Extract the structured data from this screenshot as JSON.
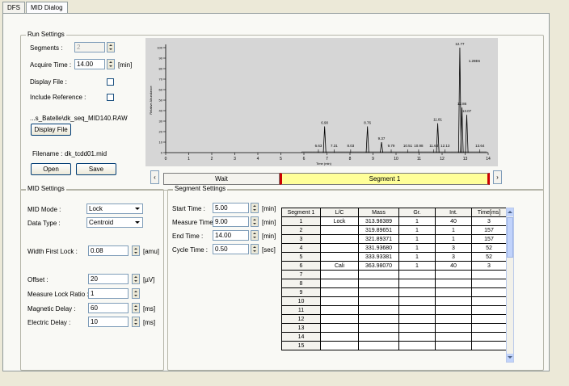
{
  "tabs": [
    {
      "label": "DFS"
    },
    {
      "label": "MID Dialog"
    }
  ],
  "run_settings": {
    "title": "Run Settings",
    "segments_label": "Segments :",
    "segments_value": "2",
    "acquire_time_label": "Acquire Time :",
    "acquire_time_value": "14.00",
    "acquire_time_unit": "[min]",
    "display_file_label": "Display File :",
    "include_reference_label": "Include Reference :",
    "file_path": "...s_Batelle\\dk_seq_MID140.RAW",
    "display_file_button": "Display File",
    "filename_label": "Filename :",
    "filename_value": "dk_tcdd01.mid",
    "open_button": "Open",
    "save_button": "Save"
  },
  "chart_data": {
    "type": "line",
    "xlabel": "Time (min)",
    "ylabel": "Relative Abundance",
    "xlim": [
      0,
      14
    ],
    "ylim": [
      0,
      100
    ],
    "x_ticks": [
      "0",
      "1",
      "2",
      "3",
      "4",
      "5",
      "6",
      "7",
      "8",
      "9",
      "10",
      "11",
      "12",
      "13",
      "14"
    ],
    "y_ticks": [
      "0",
      "10",
      "20",
      "30",
      "40",
      "50",
      "60",
      "70",
      "80",
      "90",
      "100"
    ],
    "scale_label": "1.28E6",
    "peaks": [
      {
        "label": "6.63",
        "x": 6.63,
        "y": 3
      },
      {
        "label": "6.90",
        "x": 6.9,
        "y": 25
      },
      {
        "label": "7.31",
        "x": 7.31,
        "y": 3
      },
      {
        "label": "8.03",
        "x": 8.03,
        "y": 3
      },
      {
        "label": "8.76",
        "x": 8.76,
        "y": 25
      },
      {
        "label": "9.37",
        "x": 9.37,
        "y": 10
      },
      {
        "label": "9.79",
        "x": 9.79,
        "y": 3
      },
      {
        "label": "10.51",
        "x": 10.51,
        "y": 3
      },
      {
        "label": "10.98",
        "x": 10.98,
        "y": 3
      },
      {
        "label": "11.64",
        "x": 11.64,
        "y": 3
      },
      {
        "label": "11.81",
        "x": 11.81,
        "y": 28
      },
      {
        "label": "12.13",
        "x": 12.13,
        "y": 3
      },
      {
        "label": "12.77",
        "x": 12.77,
        "y": 100
      },
      {
        "label": "12.86",
        "x": 12.86,
        "y": 43
      },
      {
        "label": "13.07",
        "x": 13.07,
        "y": 36
      },
      {
        "label": "13.64",
        "x": 13.64,
        "y": 3
      }
    ]
  },
  "timeline": {
    "wait_label": "Wait",
    "segment_label": "Segment 1"
  },
  "mid_settings": {
    "title": "MID Settings",
    "mid_mode_label": "MID Mode :",
    "mid_mode_value": "Lock",
    "data_type_label": "Data Type :",
    "data_type_value": "Centroid",
    "width_first_lock_label": "Width First Lock :",
    "width_first_lock_value": "0.08",
    "width_first_lock_unit": "[amu]",
    "offset_label": "Offset :",
    "offset_value": "20",
    "offset_unit": "[µV]",
    "measure_lock_ratio_label": "Measure Lock Ratio :",
    "measure_lock_ratio_value": "1",
    "magnetic_delay_label": "Magnetic Delay :",
    "magnetic_delay_value": "60",
    "magnetic_delay_unit": "[ms]",
    "electric_delay_label": "Electric Delay :",
    "electric_delay_value": "10",
    "electric_delay_unit": "[ms]"
  },
  "segment_settings": {
    "title": "Segment Settings",
    "start_time_label": "Start Time :",
    "start_time_value": "5.00",
    "start_time_unit": "[min]",
    "measure_time_label": "Measure Time :",
    "measure_time_value": "9.00",
    "measure_time_unit": "[min]",
    "end_time_label": "End Time :",
    "end_time_value": "14.00",
    "end_time_unit": "[min]",
    "cycle_time_label": "Cycle Time :",
    "cycle_time_value": "0.50",
    "cycle_time_unit": "[sec]"
  },
  "segment_table": {
    "headers": [
      "Segment 1",
      "L/C",
      "Mass",
      "Gr.",
      "Int.",
      "Time[ms]"
    ],
    "rows": [
      [
        "1",
        "Lock",
        "313.98389",
        "1",
        "40",
        "3"
      ],
      [
        "2",
        "",
        "319.89651",
        "1",
        "1",
        "157"
      ],
      [
        "3",
        "",
        "321.89371",
        "1",
        "1",
        "157"
      ],
      [
        "4",
        "",
        "331.93680",
        "1",
        "3",
        "52"
      ],
      [
        "5",
        "",
        "333.93381",
        "1",
        "3",
        "52"
      ],
      [
        "6",
        "Cali",
        "363.98070",
        "1",
        "40",
        "3"
      ],
      [
        "7",
        "",
        "",
        "",
        "",
        ""
      ],
      [
        "8",
        "",
        "",
        "",
        "",
        ""
      ],
      [
        "9",
        "",
        "",
        "",
        "",
        ""
      ],
      [
        "10",
        "",
        "",
        "",
        "",
        ""
      ],
      [
        "11",
        "",
        "",
        "",
        "",
        ""
      ],
      [
        "12",
        "",
        "",
        "",
        "",
        ""
      ],
      [
        "13",
        "",
        "",
        "",
        "",
        ""
      ],
      [
        "14",
        "",
        "",
        "",
        "",
        ""
      ],
      [
        "15",
        "",
        "",
        "",
        "",
        ""
      ]
    ]
  }
}
